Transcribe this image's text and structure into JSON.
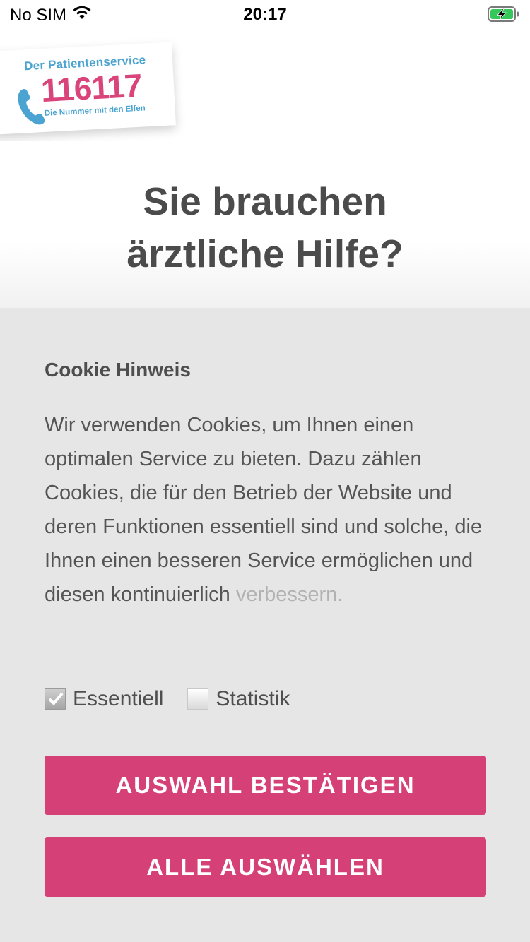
{
  "status_bar": {
    "carrier": "No SIM",
    "time": "20:17",
    "battery_color": "#35c759"
  },
  "logo": {
    "title": "Der Patientenservice",
    "number": "116117",
    "tagline": "Die Nummer mit den Elfen",
    "colors": {
      "blue": "#4aa3d0",
      "pink": "#d9457a"
    }
  },
  "headline": {
    "line1": "Sie brauchen",
    "line2": "ärztliche Hilfe?"
  },
  "cookie": {
    "title": "Cookie Hinweis",
    "text_main": "Wir verwenden Cookies, um Ihnen einen optimalen Service zu bieten. Dazu zählen Cookies, die für den Betrieb der Website und deren Funktionen essentiell sind und solche, die Ihnen einen besseren Service ermöglichen und diesen kontinuierlich",
    "text_faded": "verbessern.",
    "options": [
      {
        "label": "Essentiell",
        "checked": true
      },
      {
        "label": "Statistik",
        "checked": false
      }
    ],
    "buttons": {
      "confirm": "AUSWAHL BESTÄTIGEN",
      "select_all": "ALLE AUSWÄHLEN"
    },
    "accent_color": "#d54176"
  }
}
